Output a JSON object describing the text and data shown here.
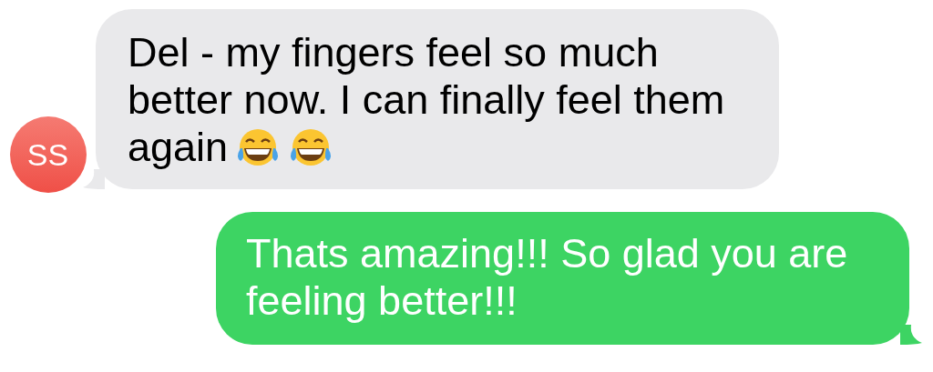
{
  "messages": [
    {
      "kind": "received",
      "avatar": "SS",
      "text": "Del - my fingers feel so much better now. I can finally feel them again",
      "emoji": [
        {
          "kind": "tears-of-joy"
        },
        {
          "kind": "tears-of-joy"
        }
      ]
    },
    {
      "kind": "sent",
      "text": "Thats amazing!!! So glad you are feeling better!!!"
    }
  ]
}
